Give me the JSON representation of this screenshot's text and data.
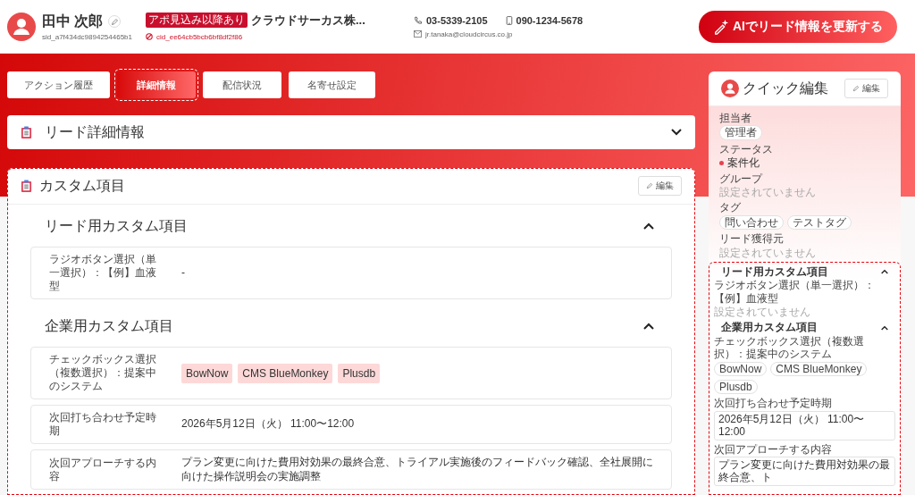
{
  "header": {
    "name": "田中 次郎",
    "sid": "sid_a7f434dc9894254465b1",
    "badge": "アポ見込み以降あり",
    "company": "クラウドサーカス株...",
    "cid": "cid_ee64cb5bcb6bf8df2f86",
    "phone": "03-5339-2105",
    "mobile": "090-1234-5678",
    "email": "jr.tanaka@cloudcircus.co.jp",
    "ai_button": "AIでリード情報を更新する"
  },
  "tabs": [
    {
      "label": "アクション履歴",
      "selected": false
    },
    {
      "label": "詳細情報",
      "selected": true
    },
    {
      "label": "配信状況",
      "selected": false
    },
    {
      "label": "名寄せ設定",
      "selected": false
    }
  ],
  "lead_detail": {
    "title": "リード詳細情報",
    "expanded": false
  },
  "custom": {
    "title": "カスタム項目",
    "edit_button": "編集",
    "sections": [
      {
        "title": "リード用カスタム項目",
        "expanded": true,
        "fields": [
          {
            "label": "ラジオボタン選択（単一選択）：【例】血液型",
            "kind": "text",
            "value": "-"
          }
        ]
      },
      {
        "title": "企業用カスタム項目",
        "expanded": true,
        "fields": [
          {
            "label": "チェックボックス選択（複数選択）：提案中のシステム",
            "kind": "tags",
            "tags": [
              "BowNow",
              "CMS BlueMonkey",
              "Plusdb"
            ]
          },
          {
            "label": "次回打ち合わせ予定時期",
            "kind": "text",
            "value": "2026年5月12日（火） 11:00〜12:00"
          },
          {
            "label": "次回アプローチする内容",
            "kind": "text",
            "value": "プラン変更に向けた費用対効果の最終合意、トライアル実施後のフィードバック確認、全社展開に向けた操作説明会の実施調整"
          }
        ]
      }
    ]
  },
  "quick_edit": {
    "title": "クイック編集",
    "edit_button": "編集",
    "fields": [
      {
        "label": "担当者",
        "kind": "tags",
        "tags": [
          "管理者"
        ]
      },
      {
        "label": "ステータス",
        "kind": "status",
        "value": "案件化",
        "color": "#e8414f"
      },
      {
        "label": "グループ",
        "kind": "empty",
        "value": "設定されていません"
      },
      {
        "label": "タグ",
        "kind": "tags",
        "tags": [
          "問い合わせ",
          "テストタグ"
        ]
      },
      {
        "label": "リード獲得元",
        "kind": "empty",
        "value": "設定されていません"
      }
    ],
    "sections": [
      {
        "title": "リード用カスタム項目",
        "expanded": true,
        "fields": [
          {
            "label": "ラジオボタン選択（単一選択）：【例】血液型",
            "kind": "empty",
            "value": "設定されていません"
          }
        ]
      },
      {
        "title": "企業用カスタム項目",
        "expanded": true,
        "fields": [
          {
            "label": "チェックボックス選択（複数選択）：提案中のシステム",
            "kind": "tags",
            "tags": [
              "BowNow",
              "CMS BlueMonkey",
              "Plusdb"
            ]
          },
          {
            "label": "次回打ち合わせ予定時期",
            "kind": "input",
            "value": "2026年5月12日（火） 11:00〜12:00"
          },
          {
            "label": "次回アプローチする内容",
            "kind": "input",
            "value": "プラン変更に向けた費用対効果の最終合意、ト"
          }
        ]
      }
    ]
  }
}
